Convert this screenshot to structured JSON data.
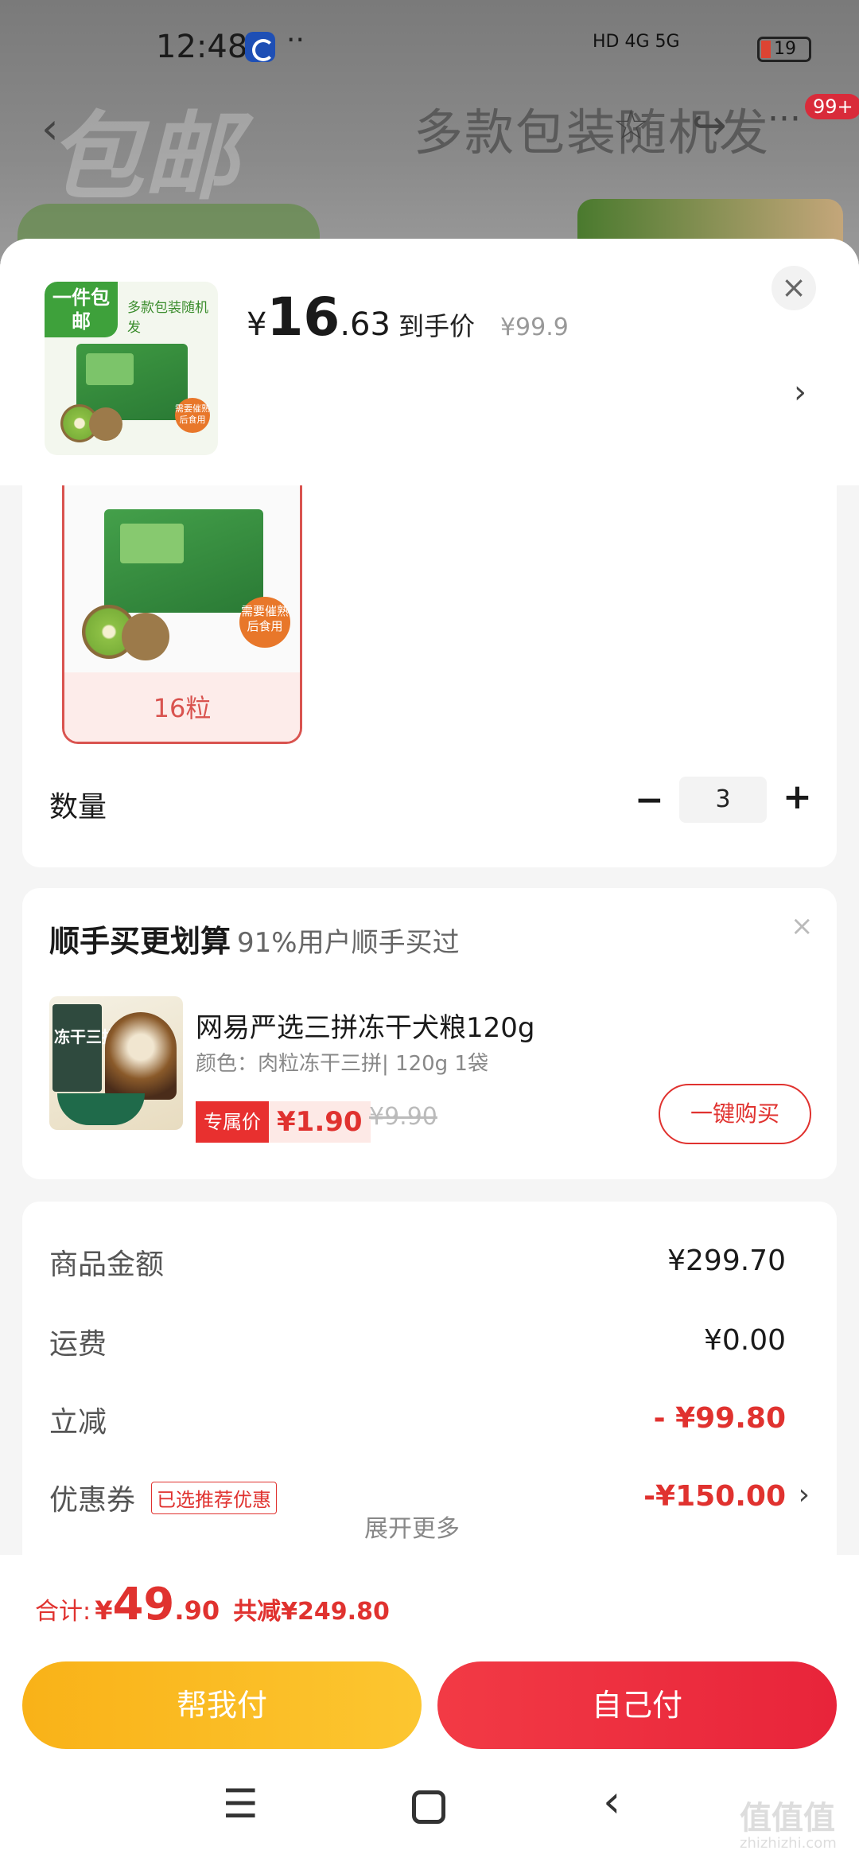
{
  "status_bar": {
    "time": "12:48",
    "signal": "HD 4G 5G",
    "battery": "19"
  },
  "background_page": {
    "title": "多款包装随机发",
    "badge": "99+",
    "deco": "包邮"
  },
  "product": {
    "thumb_tag": "一件包邮",
    "thumb_sub": "多款包装随机发",
    "thumb_sticker": "需要催熟后食用",
    "price_symbol": "¥",
    "price_int": "16",
    "price_dec": ".63",
    "price_label": "到手价",
    "original_price": "¥99.9"
  },
  "spec": {
    "label": "16粒",
    "sticker": "需要催熟后食用"
  },
  "quantity": {
    "label": "数量",
    "minus": "−",
    "value": "3",
    "plus": "+"
  },
  "recommend": {
    "title": "顺手买更划算",
    "percent": "91%用户顺手买过",
    "item_name": "网易严选三拼冻干犬粮120g",
    "item_desc": "颜色：肉粒冻干三拼| 120g 1袋",
    "img_text": "冻干三拼",
    "tag_label": "专属价",
    "tag_price": "¥1.90",
    "strike_price": "¥9.90",
    "buy_label": "一键购买"
  },
  "summary": {
    "goods_label": "商品金额",
    "goods_value": "¥299.70",
    "ship_label": "运费",
    "ship_value": "¥0.00",
    "discount_label": "立减",
    "discount_value": "- ¥99.80",
    "coupon_label": "优惠券",
    "coupon_tag": "已选推荐优惠",
    "coupon_value": "-¥150.00",
    "expand_label": "展开更多"
  },
  "footer": {
    "total_label": "合计:",
    "total_symbol": "¥",
    "total_int": "49",
    "total_dec": ".90",
    "saved": "共减¥249.80",
    "help_pay": "帮我付",
    "self_pay": "自己付"
  },
  "watermark": {
    "text": "值值值",
    "sub": "zhizhizhi.com"
  },
  "colors": {
    "accent": "#e0322f",
    "yellow": "#f9b218",
    "red_button": "#f23a45"
  }
}
